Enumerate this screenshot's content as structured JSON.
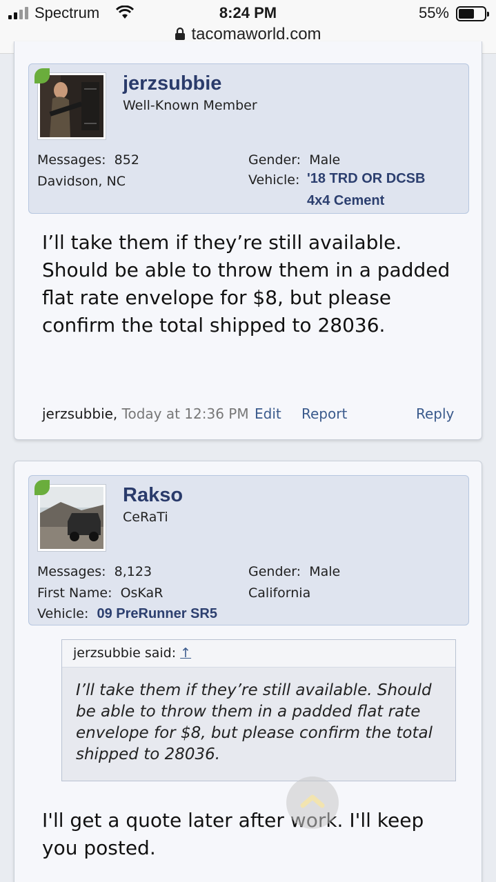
{
  "status_bar": {
    "carrier": "Spectrum",
    "time": "8:24 PM",
    "battery": "55%",
    "battery_level": 0.55,
    "url": "tacomaworld.com"
  },
  "posts": [
    {
      "username": "jerzsubbie",
      "user_title": "Well-Known Member",
      "messages_label": "Messages:",
      "messages": "852",
      "location": "Davidson, NC",
      "gender_label": "Gender:",
      "gender": "Male",
      "vehicle_label": "Vehicle:",
      "vehicle_line1": "'18 TRD OR DCSB",
      "vehicle_line2": "4x4 Cement",
      "message": "I’ll take them if they’re still available. Should be able to throw them in a padded flat rate envelope for $8, but please confirm the total shipped to 28036.",
      "footer_author": "jerzsubbie,",
      "footer_date": "Today at 12:36 PM",
      "edit": "Edit",
      "report": "Report",
      "reply": "Reply"
    },
    {
      "username": "Rakso",
      "user_title": "CeRaTi",
      "messages_label": "Messages:",
      "messages": "8,123",
      "first_name_label": "First Name:",
      "first_name": "OsKaR",
      "gender_label": "Gender:",
      "gender": "Male",
      "location": "California",
      "vehicle_label": "Vehicle:",
      "vehicle": "09 PreRunner SR5",
      "quote_author": "jerzsubbie said:",
      "quote_arrow": "↑",
      "quote_text": "I’ll take them if they’re still available. Should be able to throw them in a padded flat rate envelope for $8, but please confirm the total shipped to 28036.",
      "message": "I'll get a quote later after work. I'll keep you posted."
    }
  ],
  "icons": {
    "signal": "signal-icon",
    "wifi": "wifi-icon",
    "battery": "battery-icon",
    "lock": "lock-icon",
    "scroll_top": "chevron-up-icon"
  },
  "colors": {
    "username": "#2a3b6b",
    "link": "#3a5a8c",
    "userbox": "#dfe4ef",
    "online_marker": "#6aad3c"
  }
}
